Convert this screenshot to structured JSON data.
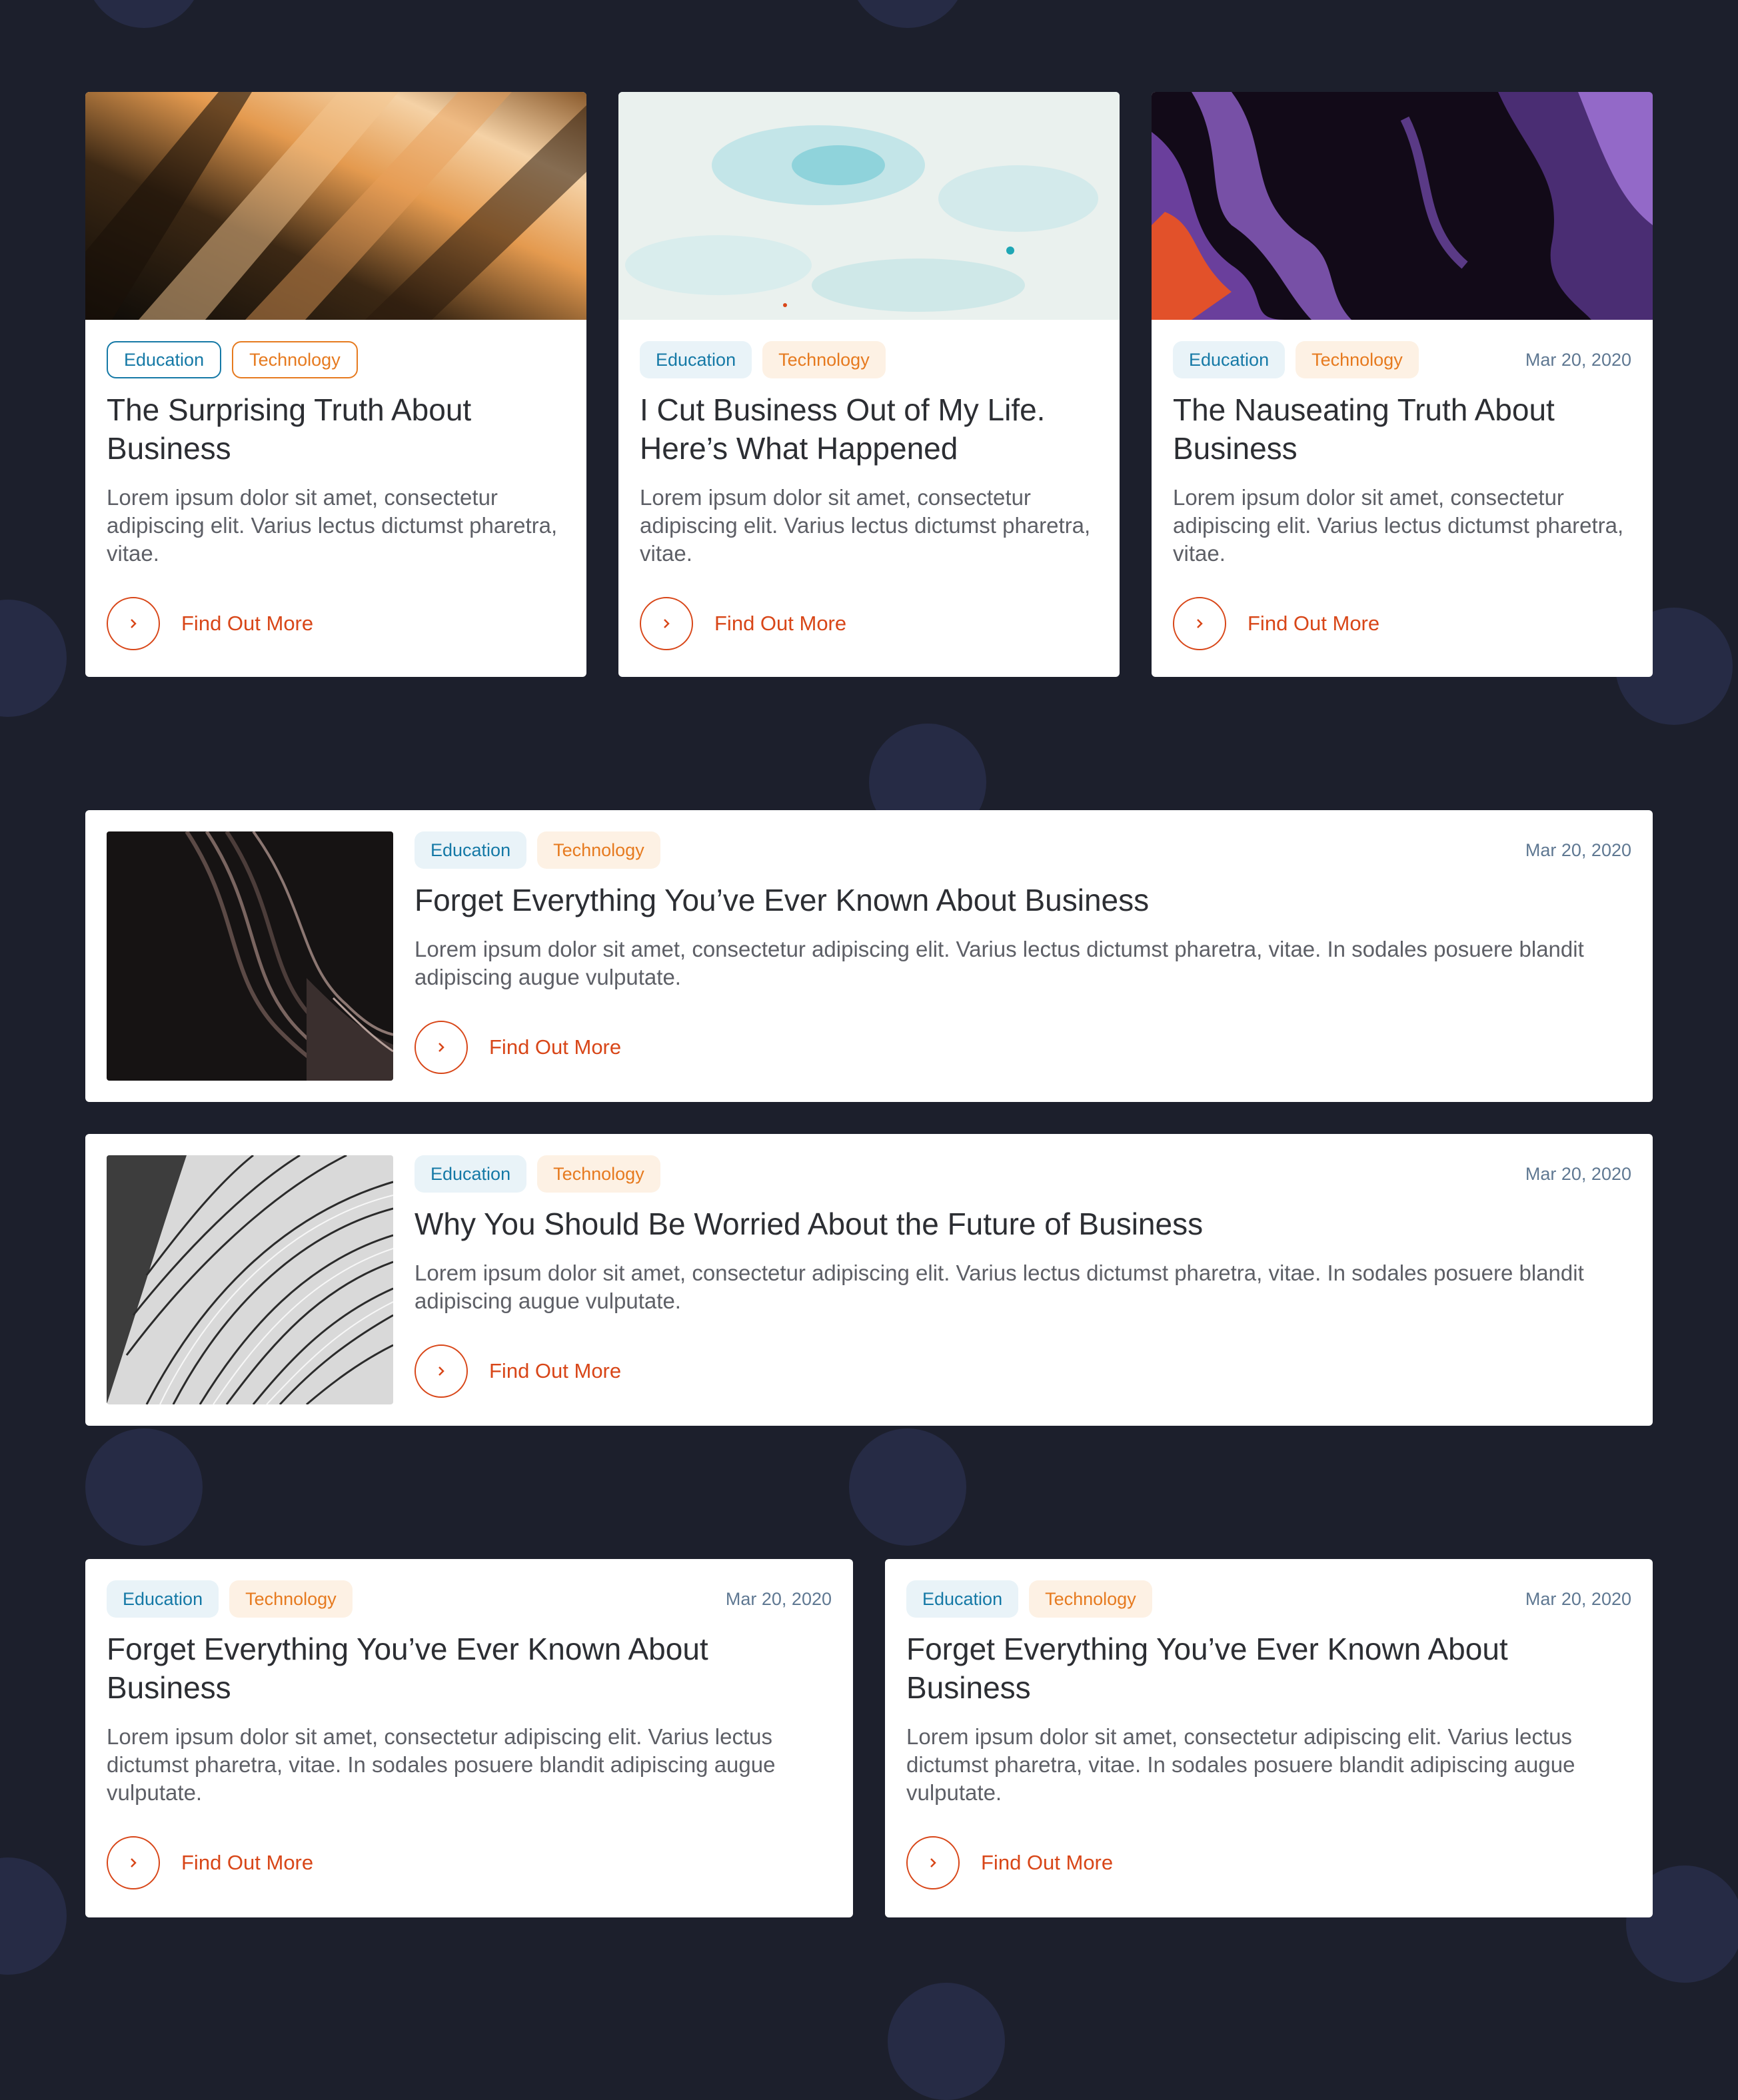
{
  "tags": {
    "education": "Education",
    "technology": "Technology"
  },
  "link_label": "Find Out More",
  "colors": {
    "background": "#1c1f2c",
    "bubble": "#262b45",
    "education_text": "#1579a6",
    "technology_text": "#e67a1f",
    "link": "#d84618",
    "date": "#5f7892"
  },
  "cards": [
    {
      "image": "amber-light-streaks-image",
      "title": "The Surprising Truth About Business",
      "excerpt": "Lorem ipsum dolor sit amet, consectetur adipiscing elit. Varius lectus dictumst pharetra, vitae."
    },
    {
      "image": "pale-blue-marble-image",
      "title": "I Cut Business Out of My Life. Here’s What Happened",
      "excerpt": "Lorem ipsum dolor sit amet, consectetur adipiscing elit. Varius lectus dictumst pharetra, vitae."
    },
    {
      "image": "purple-orange-fluid-image",
      "date": "Mar 20, 2020",
      "title": "The Nauseating Truth About Business",
      "excerpt": "Lorem ipsum dolor sit amet, consectetur adipiscing elit. Varius lectus dictumst pharetra, vitae."
    },
    {
      "image": "dark-silk-waves-image",
      "date": "Mar 20, 2020",
      "title": "Forget Everything You’ve Ever Known About Business",
      "excerpt": "Lorem ipsum dolor sit amet, consectetur adipiscing elit. Varius lectus dictumst pharetra, vitae. In sodales posuere blandit adipiscing augue vulputate."
    },
    {
      "image": "white-facade-pattern-image",
      "date": "Mar 20, 2020",
      "title": "Why You Should Be Worried About the Future of Business",
      "excerpt": "Lorem ipsum dolor sit amet, consectetur adipiscing elit. Varius lectus dictumst pharetra, vitae. In sodales posuere blandit adipiscing augue vulputate."
    },
    {
      "date": "Mar 20, 2020",
      "title": "Forget Everything You’ve Ever Known About Business",
      "excerpt": "Lorem ipsum dolor sit amet, consectetur adipiscing elit. Varius lectus dictumst pharetra, vitae. In sodales posuere blandit adipiscing augue vulputate."
    },
    {
      "date": "Mar 20, 2020",
      "title": "Forget Everything You’ve Ever Known About Business",
      "excerpt": "Lorem ipsum dolor sit amet, consectetur adipiscing elit. Varius lectus dictumst pharetra, vitae. In sodales posuere blandit adipiscing augue vulputate."
    }
  ]
}
